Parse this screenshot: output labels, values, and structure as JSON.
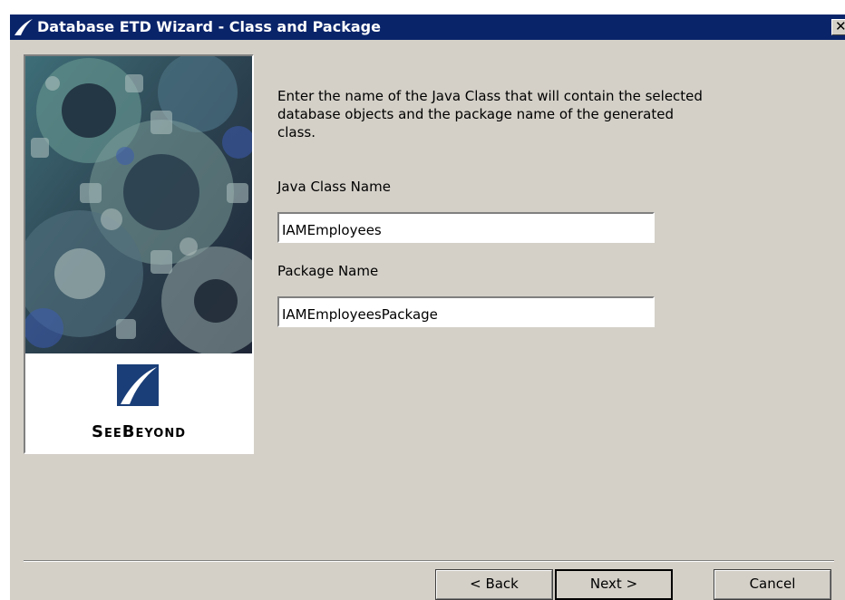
{
  "window": {
    "title": "Database ETD Wizard - Class and Package",
    "close_glyph": "✕"
  },
  "sidebar": {
    "brand": "SeeBeyond"
  },
  "main": {
    "description": "Enter the name of the Java Class that will contain the selected database objects and the package name of the generated class.",
    "java_class_label": "Java Class Name",
    "java_class_value": "IAMEmployees",
    "package_label": "Package Name",
    "package_value": "IAMEmployeesPackage"
  },
  "buttons": {
    "back": "< Back",
    "next": "Next >",
    "cancel": "Cancel"
  },
  "colors": {
    "titlebar": "#0a246a",
    "dialog_bg": "#d4d0c8",
    "brand_blue": "#1a3e78"
  },
  "icons": {
    "title": "seebeyond-swoosh-icon",
    "close": "close-icon",
    "brand": "seebeyond-logo-icon"
  }
}
